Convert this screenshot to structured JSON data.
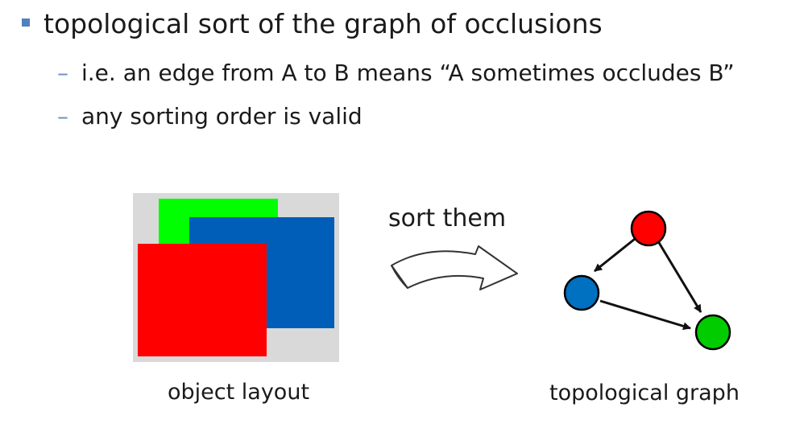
{
  "bullets": {
    "main": "topological sort of the graph of occlusions",
    "sub": [
      "i.e. an edge from A to B means “A sometimes occludes B”",
      "any sorting order is valid"
    ],
    "dash": "–"
  },
  "layout_panel": {
    "caption": "object layout",
    "background": "#d9d9d9",
    "rectangles": [
      {
        "name": "green",
        "color": "#00ff00"
      },
      {
        "name": "blue",
        "color": "#005eb8"
      },
      {
        "name": "red",
        "color": "#ff0000"
      }
    ]
  },
  "transition": {
    "label": "sort them",
    "icon": "curved-arrow-icon"
  },
  "graph": {
    "caption": "topological graph",
    "nodes": [
      {
        "name": "red",
        "color": "#ff0000"
      },
      {
        "name": "blue",
        "color": "#0070c0"
      },
      {
        "name": "green",
        "color": "#00cc00"
      }
    ],
    "edges": [
      {
        "from": "red",
        "to": "blue"
      },
      {
        "from": "red",
        "to": "green"
      },
      {
        "from": "blue",
        "to": "green"
      }
    ]
  }
}
